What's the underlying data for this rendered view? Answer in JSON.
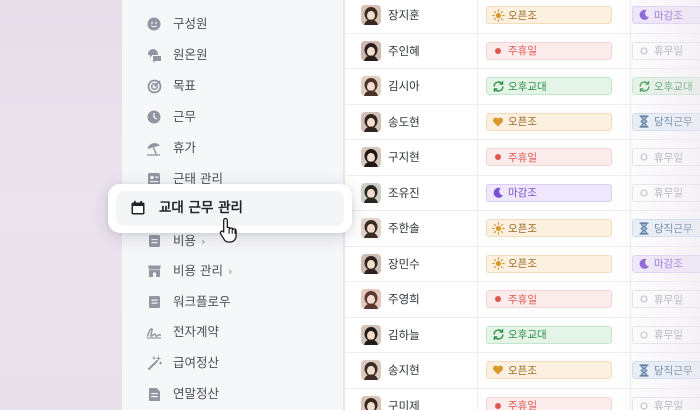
{
  "sidebar": {
    "items": [
      {
        "label": "구성원",
        "icon": "person-icon"
      },
      {
        "label": "원온원",
        "icon": "chat-bubbles-icon"
      },
      {
        "label": "목표",
        "icon": "target-icon"
      },
      {
        "label": "근무",
        "icon": "clock-icon"
      },
      {
        "label": "휴가",
        "icon": "beach-umbrella-icon"
      },
      {
        "label": "근태 관리",
        "icon": "attendance-icon"
      },
      {
        "label": "교대 근무 관리",
        "icon": "calendar-icon"
      },
      {
        "label": "비용",
        "icon": "receipt-icon",
        "chevron": "›"
      },
      {
        "label": "비용 관리",
        "icon": "store-icon",
        "chevron": "›"
      },
      {
        "label": "워크플로우",
        "icon": "document-icon"
      },
      {
        "label": "전자계약",
        "icon": "signature-icon"
      },
      {
        "label": "급여정산",
        "icon": "magic-wand-icon"
      },
      {
        "label": "연말정산",
        "icon": "tax-document-icon"
      }
    ],
    "active": "교대 근무 관리"
  },
  "shift_types": {
    "day": "오픈조",
    "off": "주휴일",
    "night": "마감조",
    "swap": "오후교대",
    "duty": "당직근무",
    "rest": "휴무일"
  },
  "colors": {
    "day": "#9a6a22",
    "off": "#e0574f",
    "night": "#7a4fd0",
    "swap": "#2f8f45",
    "duty": "#41678e",
    "rest": "#9aa0a8"
  },
  "roster": [
    {
      "name": "장지훈",
      "s1": "day",
      "s2": "night"
    },
    {
      "name": "주인혜",
      "s1": "off",
      "s2": "rest"
    },
    {
      "name": "김시아",
      "s1": "swap",
      "s2": "swap"
    },
    {
      "name": "송도현",
      "s1": "day",
      "s2": "duty"
    },
    {
      "name": "구지현",
      "s1": "off",
      "s2": "rest"
    },
    {
      "name": "조유진",
      "s1": "night",
      "s2": "rest"
    },
    {
      "name": "주한솔",
      "s1": "day",
      "s2": "duty"
    },
    {
      "name": "장민수",
      "s1": "day",
      "s2": "night"
    },
    {
      "name": "주영희",
      "s1": "off",
      "s2": "rest"
    },
    {
      "name": "김하늘",
      "s1": "swap",
      "s2": "rest"
    },
    {
      "name": "송지현",
      "s1": "day",
      "s2": "duty"
    },
    {
      "name": "구미제",
      "s1": "off",
      "s2": "rest"
    }
  ]
}
